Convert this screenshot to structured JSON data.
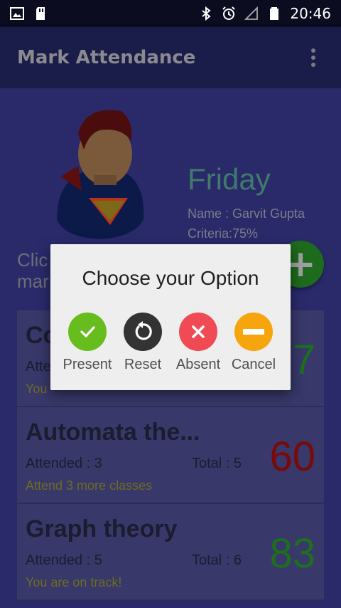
{
  "status": {
    "time": "20:46"
  },
  "app": {
    "title": "Mark Attendance"
  },
  "profile": {
    "day": "Friday",
    "name": "Name : Garvit Gupta",
    "criteria": "Criteria:75%"
  },
  "hint": {
    "line1": "Clic",
    "line2": "mar"
  },
  "subjects": [
    {
      "name": "Co",
      "attended": "Atte",
      "total": "",
      "message": "You",
      "percent": "7",
      "percent_color": "#1d6f1d"
    },
    {
      "name": "Automata the...",
      "attended": "Attended : 3",
      "total": "Total : 5",
      "message": "Attend 3 more classes",
      "percent": "60",
      "percent_color": "#7a0a0a"
    },
    {
      "name": "Graph theory",
      "attended": "Attended : 5",
      "total": "Total : 6",
      "message": "You are on track!",
      "percent": "83",
      "percent_color": "#1d6f1d"
    }
  ],
  "dialog": {
    "title": "Choose your Option",
    "options": [
      {
        "label": "Present",
        "icon": "check-icon",
        "color": "#68bd1e"
      },
      {
        "label": "Reset",
        "icon": "reset-icon",
        "color": "#333333"
      },
      {
        "label": "Absent",
        "icon": "close-icon",
        "color": "#f04a55"
      },
      {
        "label": "Cancel",
        "icon": "minus-icon",
        "color": "#f7a50c"
      }
    ]
  }
}
